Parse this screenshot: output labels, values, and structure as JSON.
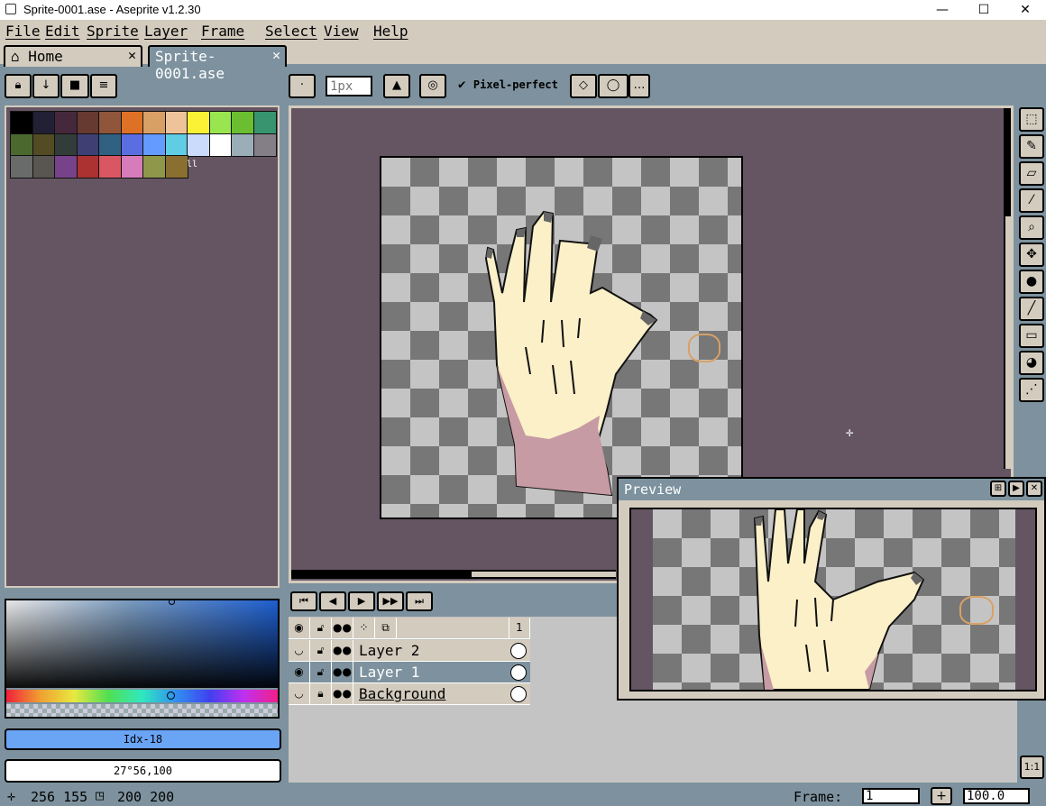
{
  "window": {
    "title": "Sprite-0001.ase - Aseprite v1.2.30",
    "minimize": "—",
    "maximize": "☐",
    "close": "✕"
  },
  "menu": [
    "File",
    "Edit",
    "Sprite",
    "Layer",
    "Frame",
    "Select",
    "View",
    "Help"
  ],
  "tabs": [
    {
      "label": "Home",
      "icon": "home-icon",
      "close": "✕"
    },
    {
      "label": "Sprite-0001.ase",
      "close": "✕"
    }
  ],
  "layer_buttons": [
    "lock-icon",
    "down-arrow-icon",
    "folder-icon",
    "menu-icon"
  ],
  "toolbar": {
    "brush_type": "·",
    "brush_size_placeholder": "1px",
    "ink_icon": "ink-icon",
    "symmetry_icon": "symmetry-icon",
    "pixel_perfect_label": "Pixel-perfect",
    "pixel_perfect_checked": true,
    "more": "…"
  },
  "palette": [
    "#000000",
    "#222034",
    "#45283c",
    "#663931",
    "#8f563b",
    "#df7126",
    "#d9a066",
    "#eec39a",
    "#fbf236",
    "#99e550",
    "#6abe30",
    "#37946e",
    "#4b692f",
    "#524b24",
    "#323c39",
    "#3f3f74",
    "#306082",
    "#5b6ee1",
    "#639bff",
    "#5fcde4",
    "#cbdbfc",
    "#ffffff",
    "#9badb7",
    "#847e87",
    "#696a6a",
    "#595652",
    "#76428a",
    "#ac3232",
    "#d95763",
    "#d77bba",
    "#8f974a",
    "#8a6f30"
  ],
  "color": {
    "index_label": "Idx-18",
    "hsv_label": "27°56,100"
  },
  "status": {
    "position": "256 155",
    "size": "200 200",
    "frame_label": "Frame:",
    "frame_value": "1",
    "zoom": "100.0"
  },
  "timeline": {
    "controls": [
      "first-frame-icon",
      "previous-frame-icon",
      "play-icon",
      "next-frame-icon",
      "last-frame-icon"
    ],
    "frame_header": "1",
    "layers": [
      {
        "name": "Layer 2",
        "visible": false,
        "selected": false
      },
      {
        "name": "Layer 1",
        "visible": true,
        "selected": true
      },
      {
        "name": "Background",
        "visible": false,
        "selected": false
      }
    ]
  },
  "tools": [
    "rectangular-marquee-icon",
    "pencil-icon",
    "eraser-icon",
    "eyedropper-icon",
    "zoom-icon",
    "move-icon",
    "paint-bucket-icon",
    "line-icon",
    "rectangle-icon",
    "blur-icon",
    "spray-icon"
  ],
  "preview": {
    "title": "Preview"
  },
  "zoom_reset_label": "1:1"
}
